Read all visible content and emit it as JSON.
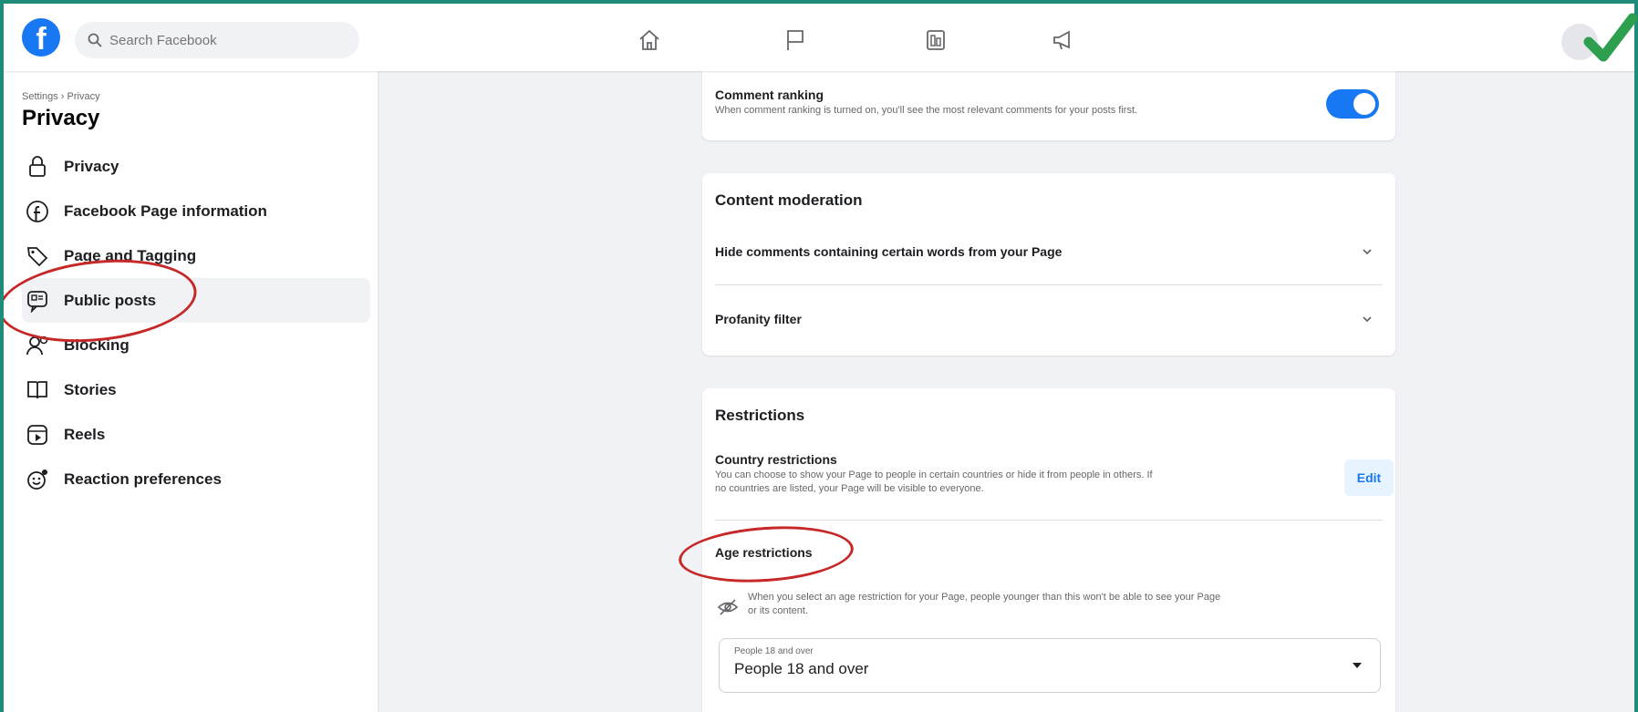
{
  "topbar": {
    "logo_letter": "f",
    "search_placeholder": "Search Facebook",
    "nav_icons": [
      "home-icon",
      "flag-icon",
      "pages-icon",
      "megaphone-icon"
    ]
  },
  "sidebar": {
    "breadcrumb": "Settings › Privacy",
    "title": "Privacy",
    "items": [
      {
        "label": "Privacy",
        "icon": "lock-icon"
      },
      {
        "label": "Facebook Page information",
        "icon": "facebook-icon"
      },
      {
        "label": "Page and Tagging",
        "icon": "tag-icon"
      },
      {
        "label": "Public posts",
        "icon": "public-posts-icon",
        "active": true
      },
      {
        "label": "Blocking",
        "icon": "blocking-icon"
      },
      {
        "label": "Stories",
        "icon": "stories-icon"
      },
      {
        "label": "Reels",
        "icon": "reels-icon"
      },
      {
        "label": "Reaction preferences",
        "icon": "reaction-icon"
      }
    ]
  },
  "comment_ranking": {
    "title": "Comment ranking",
    "description": "When comment ranking is turned on, you'll see the most relevant comments for your posts first.",
    "enabled": true
  },
  "content_moderation": {
    "heading": "Content moderation",
    "rows": [
      {
        "label": "Hide comments containing certain words from your Page"
      },
      {
        "label": "Profanity filter"
      }
    ]
  },
  "restrictions": {
    "heading": "Restrictions",
    "country": {
      "title": "Country restrictions",
      "description_1": "You can choose to show your Page to people in certain countries or hide it from people in others. If",
      "description_2": "no countries are listed, your Page will be visible to everyone.",
      "edit_label": "Edit"
    },
    "age": {
      "title": "Age restrictions",
      "note_1": "When you select an age restriction for your Page, people younger than this won't be able to see your Page",
      "note_2": "or its content.",
      "select_label": "People 18 and over",
      "select_value": "People 18 and over"
    }
  },
  "colors": {
    "accent": "#1877f2",
    "annotation": "#c62828",
    "check": "#2e9e4f",
    "frame": "#1f8c7a"
  }
}
